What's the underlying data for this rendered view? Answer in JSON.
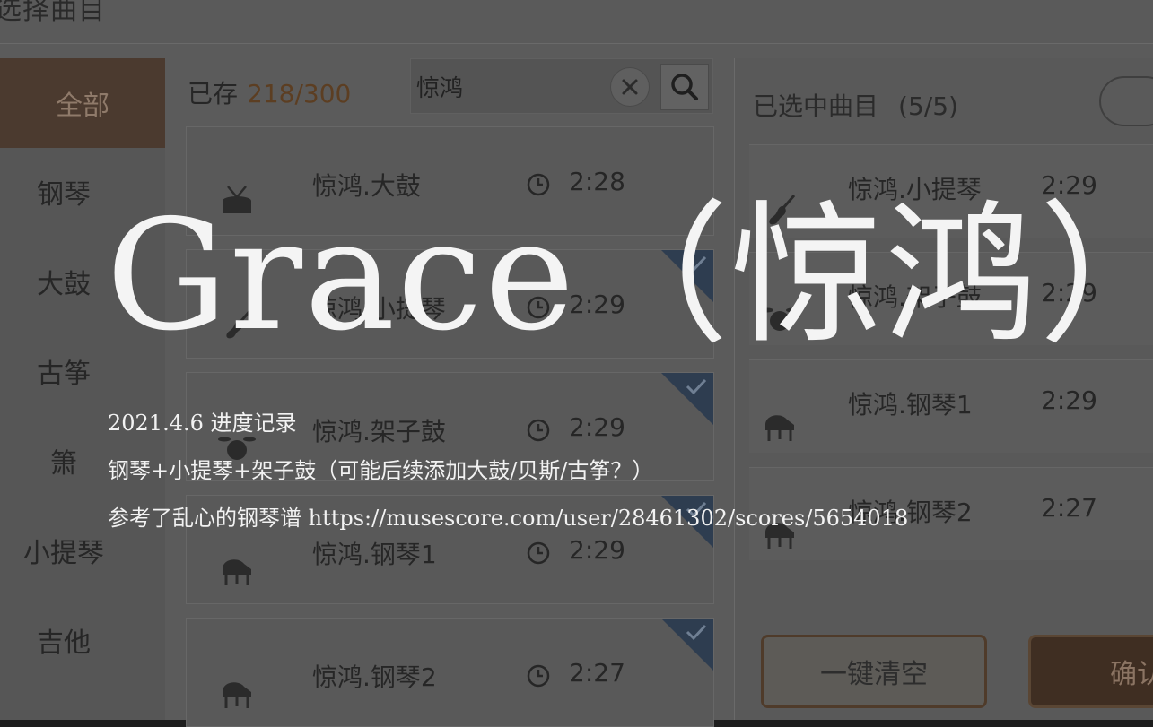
{
  "header": {
    "title": "选择曲目"
  },
  "categories": [
    {
      "label": "全部",
      "active": true
    },
    {
      "label": "钢琴"
    },
    {
      "label": "大鼓"
    },
    {
      "label": "古筝"
    },
    {
      "label": "箫"
    },
    {
      "label": "小提琴"
    },
    {
      "label": "吉他"
    }
  ],
  "library": {
    "stored_label": "已存",
    "stored_count": "218/300",
    "search_value": "惊鸿",
    "songs": [
      {
        "name": "惊鸿.大鼓",
        "time": "2:28",
        "icon": "drum-icon",
        "checked": false
      },
      {
        "name": "惊鸿.小提琴",
        "time": "2:29",
        "icon": "violin-icon",
        "checked": true
      },
      {
        "name": "惊鸿.架子鼓",
        "time": "2:29",
        "icon": "drum-kit-icon",
        "checked": true
      },
      {
        "name": "惊鸿.钢琴1",
        "time": "2:29",
        "icon": "piano-icon",
        "checked": true
      },
      {
        "name": "惊鸿.钢琴2",
        "time": "2:27",
        "icon": "piano-icon",
        "checked": true
      }
    ]
  },
  "selected": {
    "title": "已选中曲目",
    "count": "(5/5)",
    "songs": [
      {
        "name": "惊鸿.小提琴",
        "time": "2:29",
        "icon": "violin-icon"
      },
      {
        "name": "惊鸿.架子鼓",
        "time": "2:29",
        "icon": "drum-kit-icon"
      },
      {
        "name": "惊鸿.钢琴1",
        "time": "2:29",
        "icon": "piano-icon"
      },
      {
        "name": "惊鸿.钢琴2",
        "time": "2:27",
        "icon": "piano-icon"
      }
    ]
  },
  "buttons": {
    "clear_all": "一键清空",
    "confirm": "确认"
  },
  "overlay": {
    "title": "Grace（惊鸿）",
    "line1": "2021.4.6 进度记录",
    "line2": "钢琴+小提琴+架子鼓（可能后续添加大鼓/贝斯/古筝？）",
    "line3": "参考了乱心的钢琴谱 https://musescore.com/user/28461302/scores/5654018"
  },
  "colors": {
    "accent_brown": "#4b3a2f",
    "check_blue": "#2e3d50",
    "overlay_text": "#f4f4f4"
  }
}
